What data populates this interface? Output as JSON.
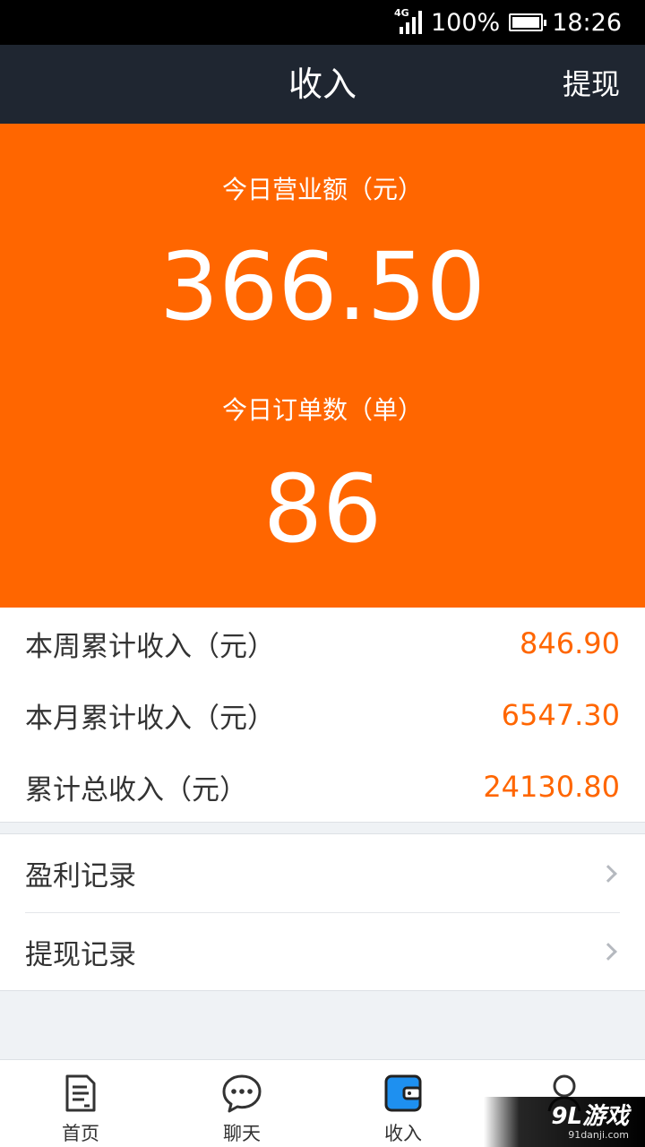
{
  "status_bar": {
    "network": "4G",
    "battery": "100%",
    "time": "18:26"
  },
  "header": {
    "title": "收入",
    "action": "提现"
  },
  "today": {
    "revenue_label": "今日营业额（元）",
    "revenue_value": "366.50",
    "orders_label": "今日订单数（单）",
    "orders_value": "86"
  },
  "stats": [
    {
      "label": "本周累计收入（元）",
      "value": "846.90"
    },
    {
      "label": "本月累计收入（元）",
      "value": "6547.30"
    },
    {
      "label": "累计总收入（元）",
      "value": "24130.80"
    }
  ],
  "records": [
    {
      "label": "盈利记录"
    },
    {
      "label": "提现记录"
    }
  ],
  "tabs": [
    {
      "label": "首页",
      "icon": "document-icon"
    },
    {
      "label": "聊天",
      "icon": "chat-bubble-icon"
    },
    {
      "label": "收入",
      "icon": "wallet-icon"
    },
    {
      "label": "",
      "icon": "user-icon"
    }
  ],
  "watermark": {
    "logo": "9L游戏",
    "url": "91danji.com"
  },
  "colors": {
    "accent": "#ff6600",
    "header_bg": "#1f2631",
    "active_icon": "#1e90f0"
  }
}
